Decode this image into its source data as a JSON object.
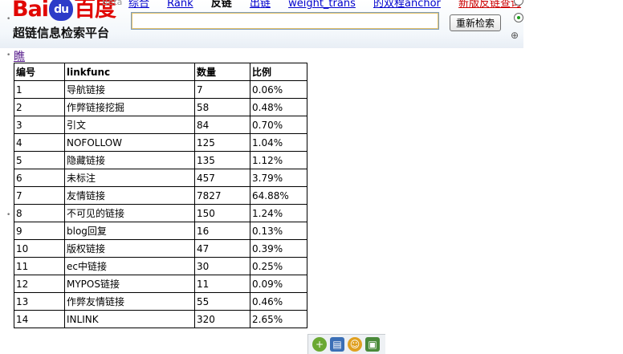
{
  "logo": {
    "brand_bai": "Bai",
    "brand_paw": "du",
    "brand_du": "百度",
    "subtitle": "超链信息检索平台",
    "beta": "Beta"
  },
  "nav": {
    "items": [
      "综合",
      "Rank",
      "反链",
      "出链",
      "weight_trans",
      "的双程anchor",
      "新版反链查询"
    ],
    "current": "反链"
  },
  "search": {
    "value": "",
    "button_label": "重新检索"
  },
  "page_link": "瞧",
  "table": {
    "headers": [
      "编号",
      "linkfunc",
      "数量",
      "比例"
    ],
    "rows": [
      [
        "1",
        "导航链接",
        "7",
        "0.06%"
      ],
      [
        "2",
        "作弊链接挖掘",
        "58",
        "0.48%"
      ],
      [
        "3",
        "引文",
        "84",
        "0.70%"
      ],
      [
        "4",
        "NOFOLLOW",
        "125",
        "1.04%"
      ],
      [
        "5",
        "隐藏链接",
        "135",
        "1.12%"
      ],
      [
        "6",
        "未标注",
        "457",
        "3.79%"
      ],
      [
        "7",
        "友情链接",
        "7827",
        "64.88%"
      ],
      [
        "8",
        "不可见的链接",
        "150",
        "1.24%"
      ],
      [
        "9",
        "blog回复",
        "16",
        "0.13%"
      ],
      [
        "10",
        "版权链接",
        "47",
        "0.39%"
      ],
      [
        "11",
        "ec中链接",
        "30",
        "0.25%"
      ],
      [
        "12",
        "MYPOS链接",
        "11",
        "0.09%"
      ],
      [
        "13",
        "作弊友情链接",
        "55",
        "0.46%"
      ],
      [
        "14",
        "INLINK",
        "320",
        "2.65%"
      ]
    ]
  },
  "icons": {
    "toolbar": [
      "add-icon",
      "save-icon",
      "smiley-icon",
      "picture-icon"
    ],
    "zoom": "zoom-icon"
  },
  "colors": {
    "brand_red": "#e10602",
    "brand_blue": "#2d3cc8",
    "link_blue": "#0000cc",
    "nav_red": "#cc0000"
  }
}
